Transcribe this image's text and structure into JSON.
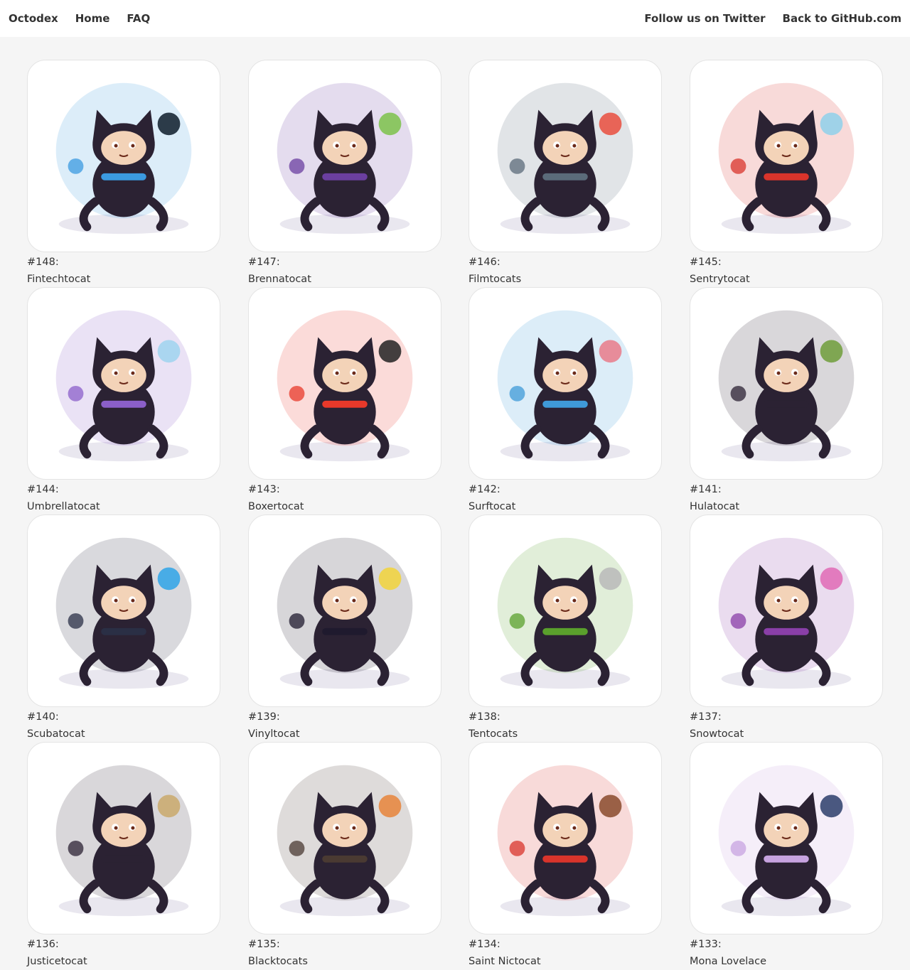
{
  "nav": {
    "brand": "Octodex",
    "home": "Home",
    "faq": "FAQ",
    "twitter": "Follow us on Twitter",
    "github": "Back to GitHub.com"
  },
  "octocats": [
    {
      "number": "#148:",
      "name": "Fintechtocat",
      "icon": "fintechtocat-image",
      "bg": "#3b9ae0",
      "accent": "#0d1b2a"
    },
    {
      "number": "#147:",
      "name": "Brennatocat",
      "icon": "brennatocat-image",
      "bg": "#6b3fa0",
      "accent": "#7cc24a"
    },
    {
      "number": "#146:",
      "name": "Filmtocats",
      "icon": "filmtocats-image",
      "bg": "#5b6b7a",
      "accent": "#e94e3d"
    },
    {
      "number": "#145:",
      "name": "Sentrytocat",
      "icon": "sentrytocat-image",
      "bg": "#d9342b",
      "accent": "#8fd0ea"
    },
    {
      "number": "#144:",
      "name": "Umbrellatocat",
      "icon": "umbrellatocat-image",
      "bg": "#8b5fc9",
      "accent": "#9fd4ee"
    },
    {
      "number": "#143:",
      "name": "Boxertocat",
      "icon": "boxertocat-image",
      "bg": "#e8392a",
      "accent": "#222222"
    },
    {
      "number": "#142:",
      "name": "Surftocat",
      "icon": "surftocat-image",
      "bg": "#3f9ad8",
      "accent": "#e97a8a"
    },
    {
      "number": "#141:",
      "name": "Hulatocat",
      "icon": "hulatocat-image",
      "bg": "#2b2233",
      "accent": "#6f9e3a"
    },
    {
      "number": "#140:",
      "name": "Scubatocat",
      "icon": "scubatocat-image",
      "bg": "#2a2f45",
      "accent": "#2ea3e8"
    },
    {
      "number": "#139:",
      "name": "Vinyltocat",
      "icon": "vinyltocat-image",
      "bg": "#1f1a2e",
      "accent": "#f2d33a"
    },
    {
      "number": "#138:",
      "name": "Tentocats",
      "icon": "tentocats-image",
      "bg": "#5aa02c",
      "accent": "#b9b9b9"
    },
    {
      "number": "#137:",
      "name": "Snowtocat",
      "icon": "snowtocat-image",
      "bg": "#8a3fa8",
      "accent": "#e06ab5"
    },
    {
      "number": "#136:",
      "name": "Justicetocat",
      "icon": "justicetocat-image",
      "bg": "#2b2233",
      "accent": "#c9a96b"
    },
    {
      "number": "#135:",
      "name": "Blacktocats",
      "icon": "blacktocats-image",
      "bg": "#4a3a32",
      "accent": "#e8843a"
    },
    {
      "number": "#134:",
      "name": "Saint Nictocat",
      "icon": "saint-nictocat-image",
      "bg": "#d9342b",
      "accent": "#8a4a2b"
    },
    {
      "number": "#133:",
      "name": "Mona Lovelace",
      "icon": "mona-lovelace-image",
      "bg": "#c7a3e0",
      "accent": "#2b3d6b"
    }
  ]
}
